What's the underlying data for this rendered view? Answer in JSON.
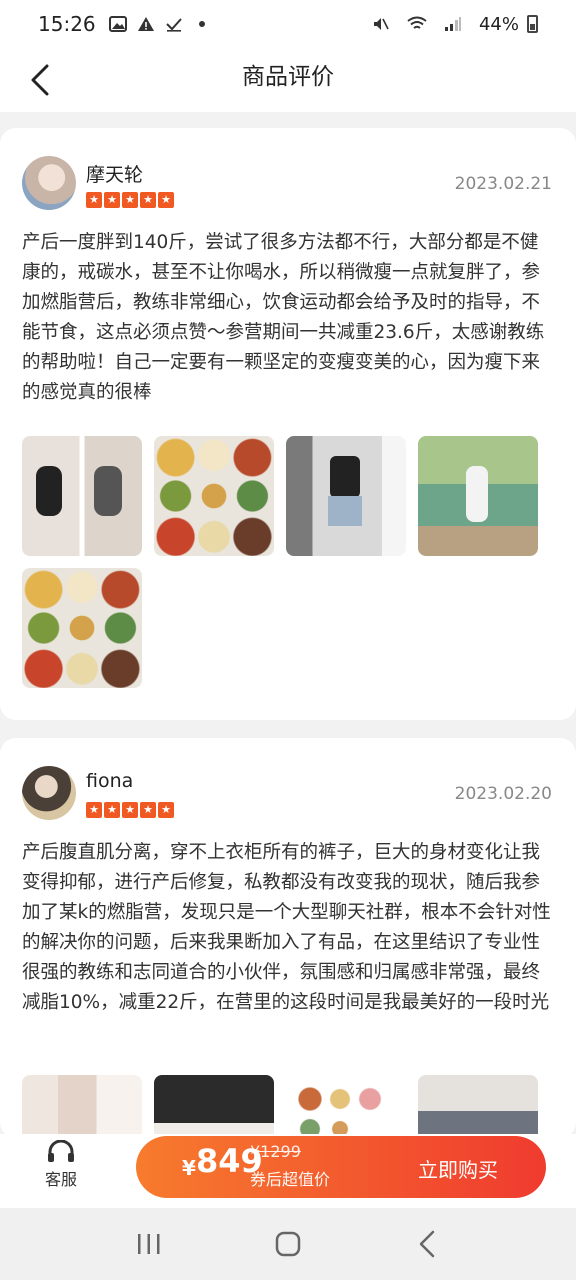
{
  "status_bar": {
    "time": "15:26",
    "battery": "44%",
    "icons": [
      "gallery-icon",
      "alert-icon",
      "check-icon",
      "dot-icon",
      "mute-icon",
      "wifi-icon",
      "signal-icon",
      "battery-icon"
    ]
  },
  "header": {
    "title": "商品评价",
    "back_icon": "chevron-left-icon"
  },
  "reviews": [
    {
      "username": "摩天轮",
      "rating": 5,
      "date": "2023.02.21",
      "text": "产后一度胖到140斤，尝试了很多方法都不行，大部分都是不健康的，戒碳水，甚至不让你喝水，所以稍微瘦一点就复胖了，参加燃脂营后，教练非常细心，饮食运动都会给予及时的指导，不能节食，这点必须点赞～参营期间一共减重23.6斤，太感谢教练的帮助啦！自己一定要有一颗坚定的变瘦变美的心，因为瘦下来的感觉真的很棒",
      "photo_count": 5
    },
    {
      "username": "fiona",
      "rating": 5,
      "date": "2023.02.20",
      "text": "产后腹直肌分离，穿不上衣柜所有的裤子，巨大的身材变化让我变得抑郁，进行产后修复，私教都没有改变我的现状，随后我参加了某k的燃脂营，发现只是一个大型聊天社群，根本不会针对性的解决你的问题，后来我果断加入了有品，在这里结识了专业性很强的教练和志同道合的小伙伴，氛围感和归属感非常强，最终减脂10%，减重22斤，在营里的这段时间是我最美好的一段时光",
      "photo_count": 4
    }
  ],
  "bottom_bar": {
    "service_label": "客服",
    "currency": "¥",
    "price": "849",
    "original_price": "¥1299",
    "price_note": "券后超值价",
    "buy_label": "立即购买"
  },
  "colors": {
    "accent": "#f05a22",
    "buy_gradient_start": "#f77b2d",
    "buy_gradient_end": "#ef3b2f"
  },
  "nav_bar": {
    "icons": [
      "recent-apps-icon",
      "home-icon",
      "back-icon"
    ]
  }
}
